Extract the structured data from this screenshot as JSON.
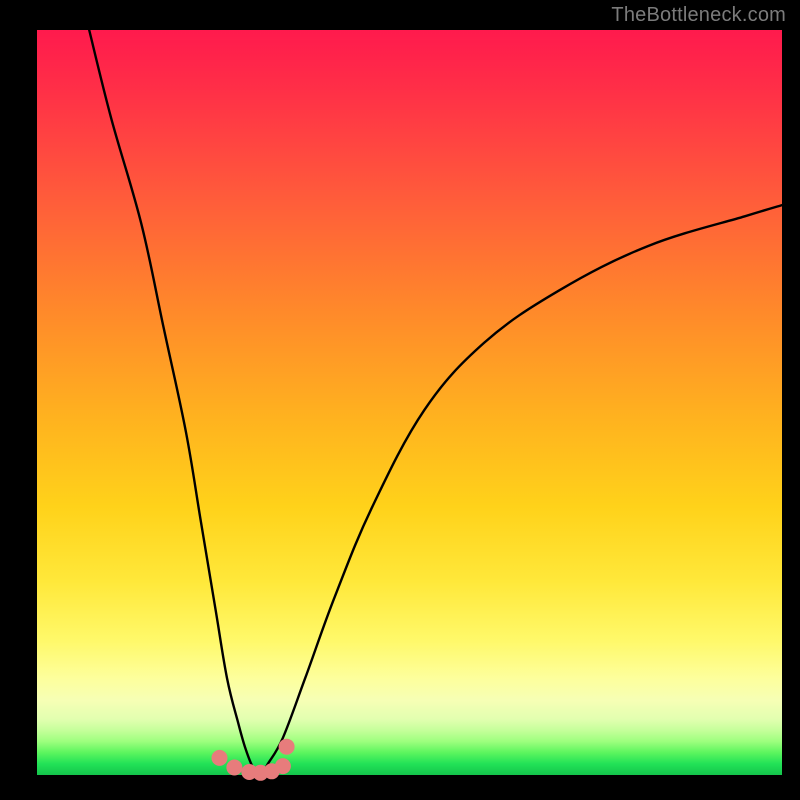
{
  "watermark": "TheBottleneck.com",
  "chart_data": {
    "type": "line",
    "title": "",
    "xlabel": "",
    "ylabel": "",
    "xlim": [
      0,
      100
    ],
    "ylim": [
      0,
      100
    ],
    "series": [
      {
        "name": "bottleneck-curve",
        "x": [
          7,
          10,
          14,
          17,
          20,
          22,
          24,
          25.5,
          27,
          28,
          29,
          30,
          31,
          33,
          36,
          40,
          45,
          52,
          60,
          70,
          82,
          95,
          100
        ],
        "values": [
          100,
          88,
          74,
          60,
          46,
          34,
          22,
          13,
          7,
          3.5,
          1,
          0,
          1.5,
          5,
          13,
          24,
          36,
          49,
          58,
          65,
          71,
          75,
          76.5
        ]
      }
    ],
    "markers": {
      "name": "dip-dots",
      "x": [
        24.5,
        26.5,
        28.5,
        30,
        31.5,
        33,
        33.5
      ],
      "values": [
        2.3,
        1.0,
        0.4,
        0.3,
        0.5,
        1.2,
        3.8
      ],
      "color": "#e77c7c",
      "radius_px": 8
    },
    "background_gradient": {
      "top": "#ff1a4d",
      "mid": "#ffd21a",
      "bottom": "#14c44c"
    }
  }
}
